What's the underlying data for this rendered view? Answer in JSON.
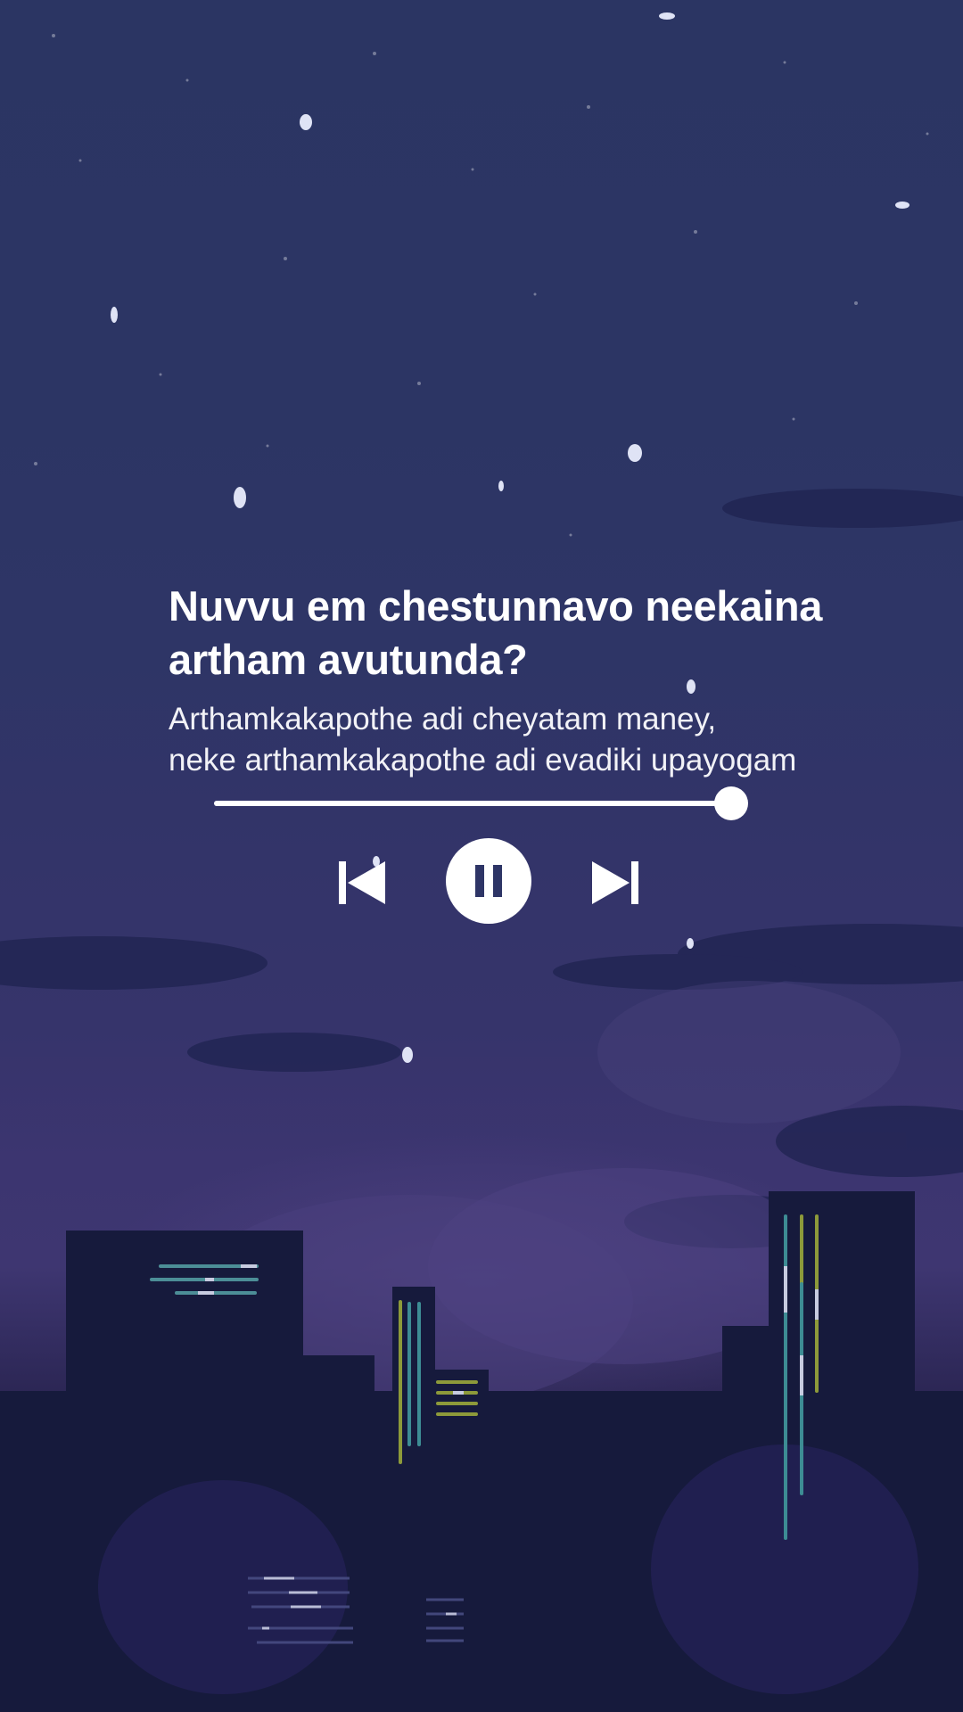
{
  "player": {
    "title": "Nuvvu em chestunnavo neekaina artham avutunda?",
    "lyric_lines": [
      "Arthamkakapothe adi cheyatam maney,",
      "neke arthamkakapothe adi evadiki upayogam"
    ],
    "progress": 0.97,
    "state": "playing"
  },
  "controls": {
    "previous_icon": "skip-previous-icon",
    "pause_icon": "pause-icon",
    "next_icon": "skip-next-icon"
  },
  "colors": {
    "sky_top": "#2b3563",
    "sky_mid": "#36346b",
    "buildings": "#161a3c",
    "text": "#ffffff",
    "window_teal": "#3d8c94",
    "window_olive": "#8d9a3a"
  }
}
